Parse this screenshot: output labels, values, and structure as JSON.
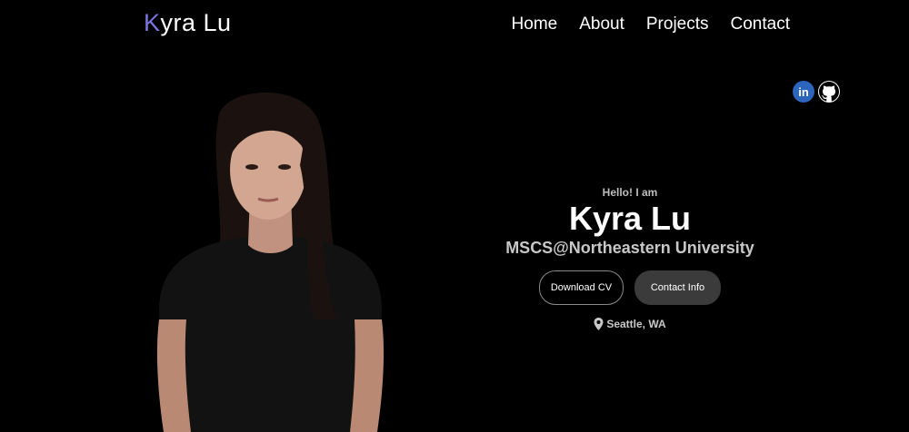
{
  "theme": {
    "accent": "#7c74e0"
  },
  "header": {
    "logo_initial": "K",
    "logo_rest": "yra Lu",
    "nav": [
      {
        "label": "Home"
      },
      {
        "label": "About"
      },
      {
        "label": "Projects"
      },
      {
        "label": "Contact"
      }
    ]
  },
  "socials": [
    {
      "icon": "linkedin-icon",
      "glyph": "in"
    },
    {
      "icon": "github-icon"
    }
  ],
  "hero": {
    "greeting": "Hello! I am",
    "name": "Kyra Lu",
    "subtitle": "MSCS@Northeastern University",
    "buttons": {
      "download": "Download CV",
      "contact": "Contact Info"
    },
    "location": "Seattle, WA"
  }
}
